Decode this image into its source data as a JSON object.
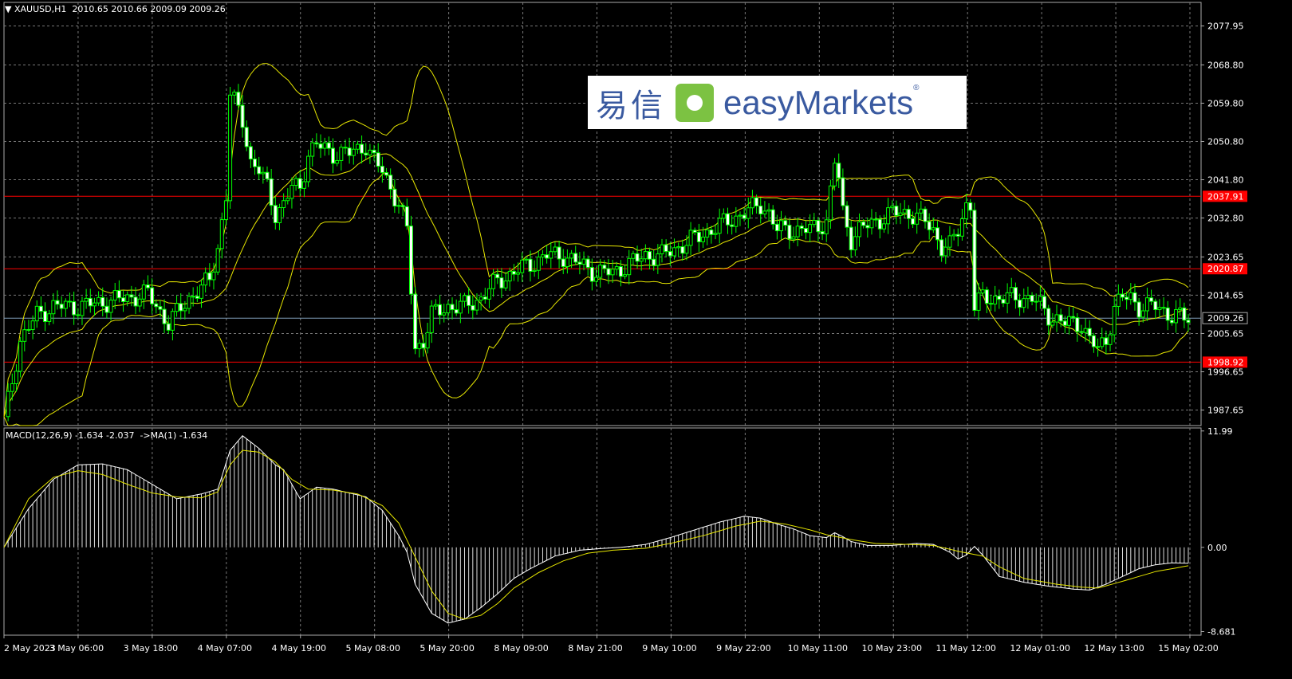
{
  "header": {
    "symbol": "XAUUSD,H1",
    "ohlc": "2010.65 2010.66 2009.09 2009.26",
    "macd_label": "MACD(12,26,9) -1.634 -2.037  ->MA(1) -1.634"
  },
  "logo": {
    "chinese": "易信",
    "english": "easyMarkets",
    "registered": "®"
  },
  "chart_data": {
    "type": "candlestick",
    "symbol": "XAUUSD",
    "timeframe": "H1",
    "price_ticks": [
      "2077.95",
      "2068.80",
      "2059.80",
      "2050.80",
      "2041.80",
      "2032.80",
      "2023.65",
      "2014.65",
      "2005.65",
      "1996.65",
      "1987.65"
    ],
    "price_tick_values": [
      2077.95,
      2068.8,
      2059.8,
      2050.8,
      2041.8,
      2032.8,
      2023.65,
      2014.65,
      2005.65,
      1996.65,
      1987.65
    ],
    "price_range": [
      1984.0,
      2083.5
    ],
    "time_labels": [
      "2 May 2023",
      "3 May 06:00",
      "3 May 18:00",
      "4 May 07:00",
      "4 May 19:00",
      "5 May 08:00",
      "5 May 20:00",
      "8 May 09:00",
      "8 May 21:00",
      "9 May 10:00",
      "9 May 22:00",
      "10 May 11:00",
      "10 May 23:00",
      "11 May 12:00",
      "12 May 01:00",
      "12 May 13:00",
      "15 May 02:00"
    ],
    "horizontal_lines": [
      {
        "value": 2037.91,
        "label": "2037.91",
        "color": "#ff0000"
      },
      {
        "value": 2020.87,
        "label": "2020.87",
        "color": "#ff0000"
      },
      {
        "value": 1998.92,
        "label": "1998.92",
        "color": "#ff0000"
      },
      {
        "value": 2009.26,
        "label": "2009.26",
        "color": "#7f9db9"
      }
    ],
    "price_path": [
      [
        0,
        1985
      ],
      [
        4,
        2004
      ],
      [
        8,
        2010
      ],
      [
        12,
        2012
      ],
      [
        18,
        2012
      ],
      [
        24,
        2013
      ],
      [
        30,
        2014
      ],
      [
        35,
        2015
      ],
      [
        40,
        2008
      ],
      [
        45,
        2014
      ],
      [
        50,
        2018
      ],
      [
        52,
        2026
      ],
      [
        54,
        2038
      ],
      [
        55,
        2062
      ],
      [
        56,
        2060
      ],
      [
        58,
        2056
      ],
      [
        60,
        2046
      ],
      [
        62,
        2044
      ],
      [
        64,
        2040
      ],
      [
        66,
        2034
      ],
      [
        68,
        2036
      ],
      [
        70,
        2040
      ],
      [
        72,
        2040
      ],
      [
        74,
        2048
      ],
      [
        76,
        2050
      ],
      [
        80,
        2048
      ],
      [
        84,
        2048
      ],
      [
        88,
        2050
      ],
      [
        90,
        2046
      ],
      [
        92,
        2044
      ],
      [
        94,
        2040
      ],
      [
        96,
        2036
      ],
      [
        98,
        2030
      ],
      [
        99,
        2016
      ],
      [
        100,
        2002
      ],
      [
        101,
        2003
      ],
      [
        102,
        2004
      ],
      [
        104,
        2010
      ],
      [
        108,
        2012
      ],
      [
        112,
        2012
      ],
      [
        116,
        2014
      ],
      [
        120,
        2018
      ],
      [
        124,
        2020
      ],
      [
        128,
        2022
      ],
      [
        132,
        2024
      ],
      [
        136,
        2024
      ],
      [
        140,
        2022
      ],
      [
        144,
        2020
      ],
      [
        148,
        2020
      ],
      [
        152,
        2022
      ],
      [
        156,
        2024
      ],
      [
        160,
        2024
      ],
      [
        164,
        2026
      ],
      [
        168,
        2028
      ],
      [
        172,
        2030
      ],
      [
        176,
        2032
      ],
      [
        180,
        2034
      ],
      [
        184,
        2036
      ],
      [
        186,
        2034
      ],
      [
        188,
        2030
      ],
      [
        192,
        2030
      ],
      [
        196,
        2030
      ],
      [
        200,
        2032
      ],
      [
        202,
        2046
      ],
      [
        203,
        2042
      ],
      [
        204,
        2034
      ],
      [
        206,
        2028
      ],
      [
        208,
        2030
      ],
      [
        212,
        2032
      ],
      [
        216,
        2034
      ],
      [
        220,
        2034
      ],
      [
        224,
        2032
      ],
      [
        226,
        2030
      ],
      [
        228,
        2026
      ],
      [
        230,
        2026
      ],
      [
        232,
        2030
      ],
      [
        234,
        2036
      ],
      [
        235,
        2036
      ],
      [
        236,
        2012
      ],
      [
        238,
        2014
      ],
      [
        242,
        2014
      ],
      [
        246,
        2014
      ],
      [
        250,
        2014
      ],
      [
        254,
        2010
      ],
      [
        258,
        2008
      ],
      [
        262,
        2008
      ],
      [
        264,
        2004
      ],
      [
        266,
        2002
      ],
      [
        268,
        2004
      ],
      [
        270,
        2012
      ],
      [
        272,
        2014
      ],
      [
        274,
        2014
      ],
      [
        276,
        2012
      ],
      [
        280,
        2012
      ],
      [
        284,
        2010
      ],
      [
        288,
        2009
      ]
    ],
    "macd": {
      "value": -1.634,
      "signal": -2.037,
      "ma_period": 1,
      "ticks": [
        "11.99",
        "0.00",
        "-8.681"
      ],
      "tick_values": [
        11.99,
        0.0,
        -8.681
      ],
      "range": [
        -9.05,
        12.3
      ],
      "histogram": [
        [
          0,
          0
        ],
        [
          6,
          4
        ],
        [
          12,
          7
        ],
        [
          18,
          8.5
        ],
        [
          24,
          8.6
        ],
        [
          30,
          8
        ],
        [
          36,
          6.5
        ],
        [
          42,
          5
        ],
        [
          48,
          5.5
        ],
        [
          52,
          6
        ],
        [
          55,
          10
        ],
        [
          58,
          11.5
        ],
        [
          62,
          10.2
        ],
        [
          66,
          8.5
        ],
        [
          68,
          8
        ],
        [
          70,
          6.5
        ],
        [
          72,
          5
        ],
        [
          76,
          6.2
        ],
        [
          80,
          6
        ],
        [
          84,
          5.6
        ],
        [
          88,
          5.2
        ],
        [
          92,
          3.8
        ],
        [
          96,
          1.2
        ],
        [
          98,
          -0.5
        ],
        [
          100,
          -3.8
        ],
        [
          104,
          -6.8
        ],
        [
          108,
          -7.8
        ],
        [
          112,
          -7.4
        ],
        [
          116,
          -6.2
        ],
        [
          120,
          -4.8
        ],
        [
          124,
          -3.2
        ],
        [
          128,
          -2.2
        ],
        [
          134,
          -0.9
        ],
        [
          140,
          -0.3
        ],
        [
          146,
          -0.1
        ],
        [
          150,
          0
        ],
        [
          156,
          0.3
        ],
        [
          162,
          1
        ],
        [
          168,
          1.8
        ],
        [
          174,
          2.6
        ],
        [
          180,
          3.2
        ],
        [
          184,
          3
        ],
        [
          188,
          2.4
        ],
        [
          192,
          1.9
        ],
        [
          196,
          1.2
        ],
        [
          200,
          1
        ],
        [
          202,
          1.5
        ],
        [
          204,
          1.1
        ],
        [
          206,
          0.6
        ],
        [
          210,
          0.2
        ],
        [
          216,
          0.2
        ],
        [
          222,
          0.4
        ],
        [
          226,
          0.3
        ],
        [
          230,
          -0.5
        ],
        [
          232,
          -1.2
        ],
        [
          234,
          -0.8
        ],
        [
          236,
          0.1
        ],
        [
          238,
          -0.8
        ],
        [
          242,
          -3
        ],
        [
          248,
          -3.6
        ],
        [
          254,
          -4
        ],
        [
          260,
          -4.3
        ],
        [
          264,
          -4.4
        ],
        [
          268,
          -3.8
        ],
        [
          272,
          -3
        ],
        [
          276,
          -2.2
        ],
        [
          280,
          -1.8
        ],
        [
          284,
          -1.6
        ],
        [
          288,
          -1.634
        ]
      ],
      "signal_path": [
        [
          0,
          0
        ],
        [
          6,
          5
        ],
        [
          12,
          7.2
        ],
        [
          18,
          7.9
        ],
        [
          24,
          7.5
        ],
        [
          30,
          6.5
        ],
        [
          36,
          5.6
        ],
        [
          42,
          5.2
        ],
        [
          48,
          5.1
        ],
        [
          52,
          5.7
        ],
        [
          55,
          8.5
        ],
        [
          58,
          10
        ],
        [
          62,
          9.8
        ],
        [
          66,
          8.8
        ],
        [
          70,
          7
        ],
        [
          74,
          6
        ],
        [
          80,
          5.9
        ],
        [
          86,
          5.5
        ],
        [
          92,
          4.3
        ],
        [
          96,
          2.5
        ],
        [
          100,
          -1
        ],
        [
          104,
          -4.5
        ],
        [
          108,
          -6.8
        ],
        [
          112,
          -7.4
        ],
        [
          116,
          -7
        ],
        [
          120,
          -5.8
        ],
        [
          124,
          -4.2
        ],
        [
          130,
          -2.6
        ],
        [
          136,
          -1.4
        ],
        [
          142,
          -0.6
        ],
        [
          148,
          -0.3
        ],
        [
          156,
          -0.1
        ],
        [
          162,
          0.4
        ],
        [
          170,
          1.2
        ],
        [
          178,
          2.2
        ],
        [
          184,
          2.7
        ],
        [
          190,
          2.4
        ],
        [
          196,
          1.8
        ],
        [
          200,
          1.3
        ],
        [
          206,
          0.8
        ],
        [
          212,
          0.4
        ],
        [
          220,
          0.3
        ],
        [
          226,
          0.2
        ],
        [
          232,
          -0.4
        ],
        [
          238,
          -0.9
        ],
        [
          242,
          -2
        ],
        [
          248,
          -3.2
        ],
        [
          256,
          -3.8
        ],
        [
          262,
          -4.1
        ],
        [
          266,
          -4.2
        ],
        [
          272,
          -3.5
        ],
        [
          280,
          -2.5
        ],
        [
          288,
          -1.9
        ]
      ]
    }
  }
}
